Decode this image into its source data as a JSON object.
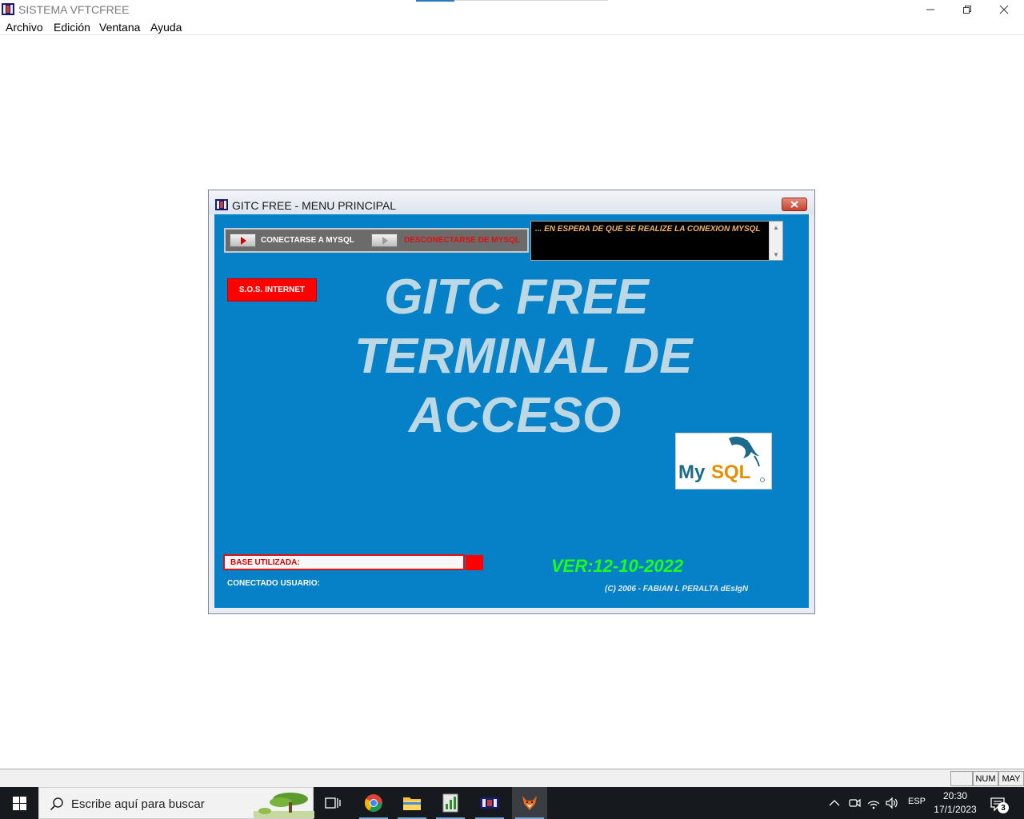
{
  "window": {
    "title": "SISTEMA VFTCFREE",
    "controls": [
      "minimize",
      "restore",
      "close"
    ]
  },
  "menu": {
    "items": [
      "Archivo",
      "Edición",
      "Ventana",
      "Ayuda"
    ]
  },
  "dialog": {
    "title": "GITC  FREE - MENU PRINCIPAL",
    "close_icon": "close-icon",
    "connect_label": "CONECTARSE A MYSQL",
    "disconnect_label": "DESCONECTARSE DE MYSQL",
    "status_message": "... EN ESPERA DE QUE SE REALIZE LA CONEXION MYSQL",
    "sos_label": "S.O.S. INTERNET",
    "headline": [
      "GITC  FREE",
      "TERMINAL DE",
      "ACCESO"
    ],
    "logo_text": "MySQL",
    "base_label": "BASE UTILIZADA:",
    "user_label": "CONECTADO USUARIO:",
    "version": "VER:12-10-2022",
    "copyright": "(C)  2006 - FABIAN L PERALTA dEsIgN",
    "colors": {
      "body": "#0680c6",
      "headline": "#bcd8e4",
      "version": "#19ff19",
      "alert": "#ff0000",
      "status_text": "#f0b36a"
    }
  },
  "statusbar": {
    "num": "NUM",
    "may": "MAY"
  },
  "taskbar": {
    "search_placeholder": "Escribe aquí para buscar",
    "apps": [
      "task-view-icon",
      "chrome-icon",
      "file-explorer-icon",
      "spreadsheet-icon",
      "film-app-icon",
      "fox-app-icon"
    ],
    "language": "ESP",
    "time": "20:30",
    "date": "17/1/2023",
    "notifications": "3"
  }
}
